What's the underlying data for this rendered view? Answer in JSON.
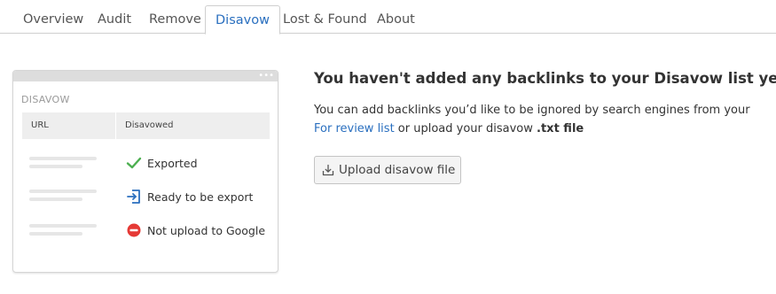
{
  "tabs": [
    {
      "label": "Overview"
    },
    {
      "label": "Audit"
    },
    {
      "label": "Remove"
    },
    {
      "label": "Disavow"
    },
    {
      "label": "Lost & Found"
    },
    {
      "label": "About"
    }
  ],
  "active_tab": "Disavow",
  "illustration": {
    "title": "DISAVOW",
    "columns": [
      "URL",
      "Disavowed"
    ],
    "rows": [
      {
        "status": "Exported",
        "icon": "checkmark-icon"
      },
      {
        "status": "Ready to be export",
        "icon": "export-icon"
      },
      {
        "status": "Not upload to Google",
        "icon": "stop-icon"
      }
    ]
  },
  "empty_state": {
    "title": "You haven't added any backlinks to your Disavow list yet",
    "desc_part1": "You can add backlinks you’d like to be ignored by search engines from your",
    "review_link": "For review list",
    "desc_part2": " or upload your disavow ",
    "file_ext": ".txt file",
    "upload_button": "Upload disavow file"
  },
  "colors": {
    "accent_blue": "#2a6fbf",
    "success_green": "#4caf50",
    "error_red": "#e53935",
    "border": "#cfcfcf"
  }
}
